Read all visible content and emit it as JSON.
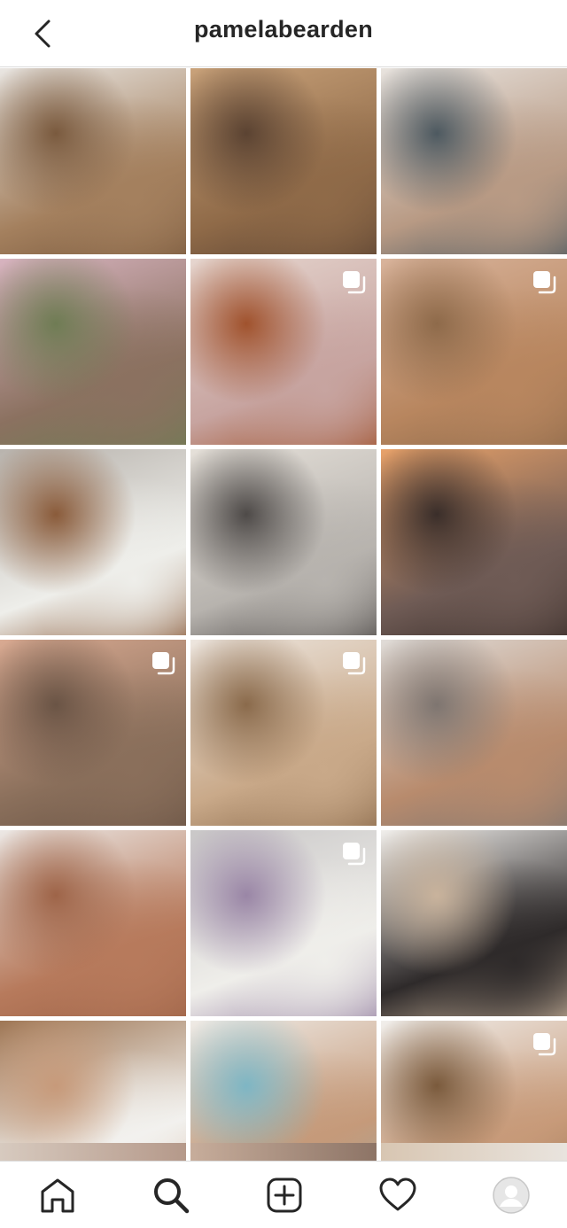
{
  "header": {
    "username": "pamelabearden",
    "back_icon": "chevron-left-icon"
  },
  "grid": {
    "tiles": [
      {
        "name": "post-bathroom-vanity",
        "colors": [
          "#e9e6e2",
          "#a4805e",
          "#7a5a3e"
        ],
        "carousel": false
      },
      {
        "name": "post-restaurant-interior",
        "colors": [
          "#c9a27a",
          "#8f6a48",
          "#5b4332"
        ],
        "carousel": false
      },
      {
        "name": "post-tattoo",
        "colors": [
          "#e8e3de",
          "#b89a84",
          "#4d5960"
        ],
        "carousel": false
      },
      {
        "name": "post-magnolia-tree",
        "colors": [
          "#d8b4c0",
          "#8b7160",
          "#6f7c54"
        ],
        "carousel": false
      },
      {
        "name": "post-cafe-mural",
        "colors": [
          "#e6d6cf",
          "#c7a4a0",
          "#a0522d"
        ],
        "carousel": true
      },
      {
        "name": "post-selfie-portrait",
        "colors": [
          "#d9b49c",
          "#b8865f",
          "#8e6a4a"
        ],
        "carousel": true
      },
      {
        "name": "post-white-tiles",
        "colors": [
          "#b8b3ad",
          "#eeeeea",
          "#8a5b3a"
        ],
        "carousel": false
      },
      {
        "name": "post-child-sweater",
        "colors": [
          "#e5e0d9",
          "#b7b3ae",
          "#4e4a48"
        ],
        "carousel": false
      },
      {
        "name": "post-sunset-trees",
        "colors": [
          "#e8a26a",
          "#6f5b55",
          "#3a2e2a"
        ],
        "carousel": false
      },
      {
        "name": "post-close-selfie",
        "colors": [
          "#d9aa92",
          "#8a6f5b",
          "#6a5445"
        ],
        "carousel": true
      },
      {
        "name": "post-dried-flowers",
        "colors": [
          "#ede6df",
          "#c9a989",
          "#8a6a4b"
        ],
        "carousel": true
      },
      {
        "name": "post-airplane-child",
        "colors": [
          "#e0dcd8",
          "#b88b6d",
          "#7e7570"
        ],
        "carousel": false
      },
      {
        "name": "post-two-children",
        "colors": [
          "#ece8e5",
          "#b77a5c",
          "#9e6448"
        ],
        "carousel": false
      },
      {
        "name": "post-birthday-cake",
        "colors": [
          "#c9c7c7",
          "#efeeea",
          "#9a86a6"
        ],
        "carousel": true
      },
      {
        "name": "post-staircase-shelves",
        "colors": [
          "#f1efec",
          "#2e2a2a",
          "#c9b39c"
        ],
        "carousel": false
      },
      {
        "name": "post-book-coffee",
        "colors": [
          "#9e7654",
          "#f2f1ee",
          "#c79a7a"
        ],
        "carousel": false
      },
      {
        "name": "post-kids-bedroom",
        "colors": [
          "#efebe6",
          "#c59a7a",
          "#7eb6c4"
        ],
        "carousel": false
      },
      {
        "name": "post-child-straw-hat",
        "colors": [
          "#f1efec",
          "#c79a79",
          "#7a5a3c"
        ],
        "carousel": true
      }
    ],
    "partial_row": [
      {
        "name": "post-partial-1",
        "colors": [
          "#d7cabf",
          "#b5998a"
        ]
      },
      {
        "name": "post-partial-2",
        "colors": [
          "#c7ad9b",
          "#8d7466"
        ]
      },
      {
        "name": "post-partial-3",
        "colors": [
          "#d8c6b2",
          "#e9e4de"
        ]
      }
    ]
  },
  "tabbar": {
    "items": [
      {
        "name": "home-icon"
      },
      {
        "name": "search-icon",
        "active": true
      },
      {
        "name": "new-post-icon"
      },
      {
        "name": "activity-heart-icon"
      },
      {
        "name": "profile-avatar-icon"
      }
    ]
  }
}
